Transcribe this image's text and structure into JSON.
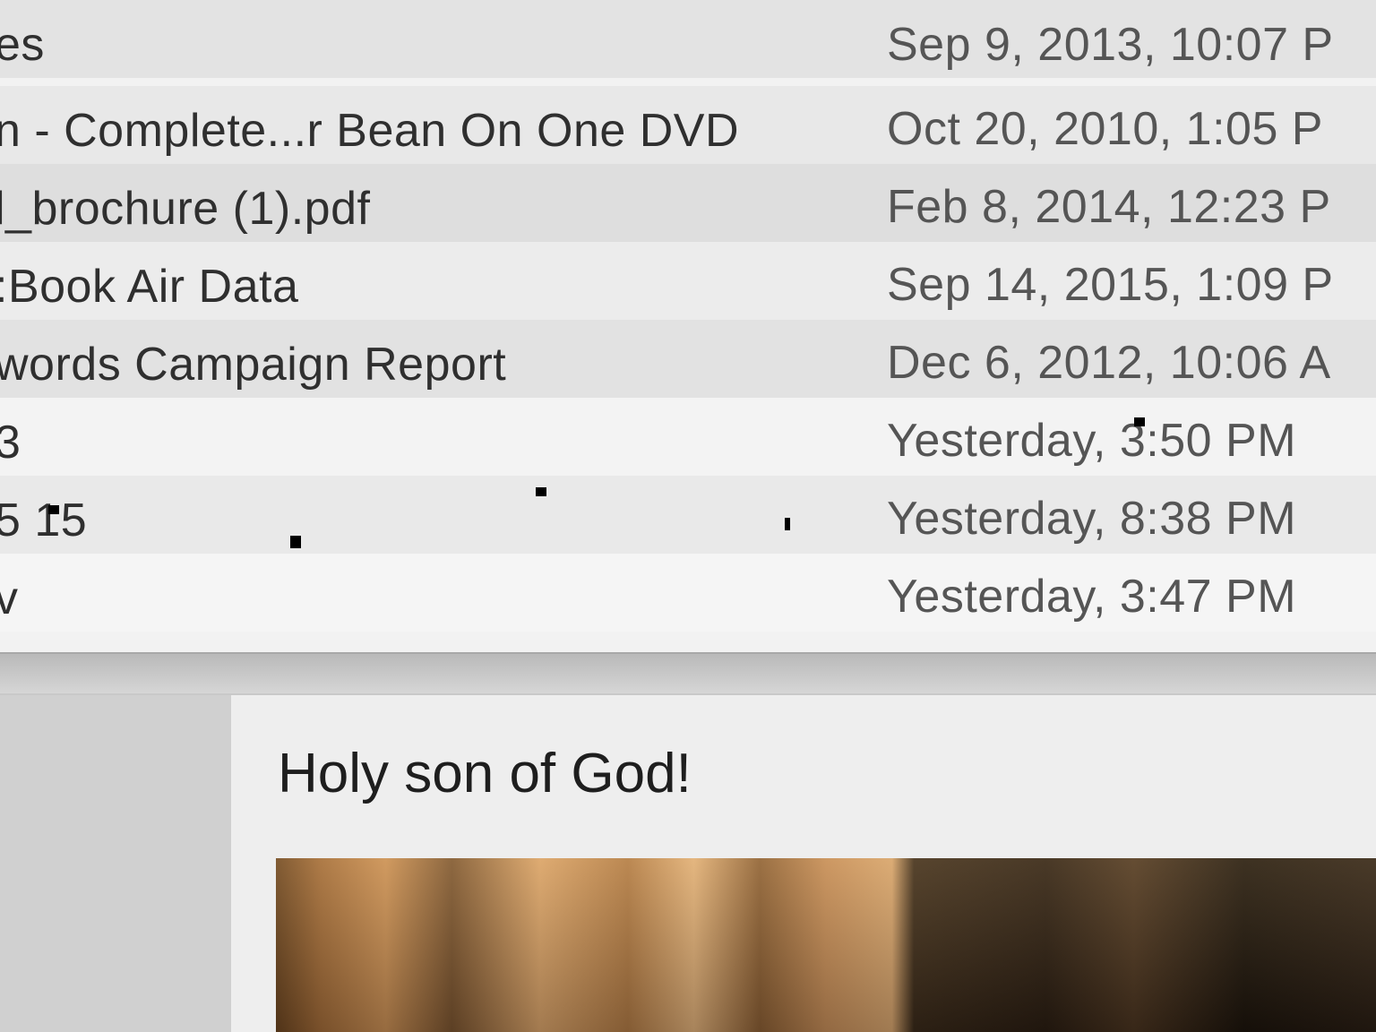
{
  "file_list": {
    "partial_header": "",
    "rows": [
      {
        "name": "es",
        "date": "Sep 9, 2013, 10:07 P"
      },
      {
        "name": "n - Complete...r Bean On One DVD",
        "date": "Oct 20, 2010, 1:05 P"
      },
      {
        "name": "l_brochure (1).pdf",
        "date": "Feb 8, 2014, 12:23 P"
      },
      {
        "name": ":Book Air Data",
        "date": "Sep 14, 2015, 1:09 P"
      },
      {
        "name": "words Campaign Report",
        "date": "Dec 6, 2012, 10:06 A"
      },
      {
        "name": "3",
        "date": "Yesterday, 3:50 PM"
      },
      {
        "name": "5 15",
        "date": "Yesterday, 8:38 PM"
      },
      {
        "name": "v",
        "date": "Yesterday, 3:47 PM"
      }
    ]
  },
  "message": {
    "heading": "Holy son of God!"
  }
}
